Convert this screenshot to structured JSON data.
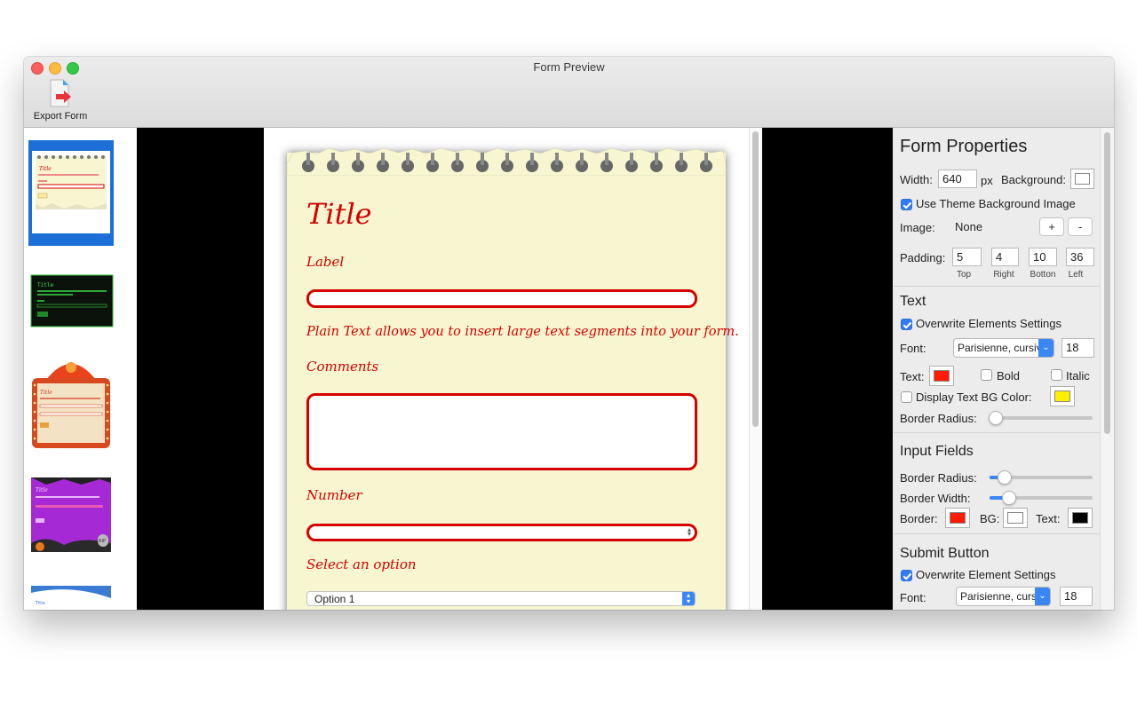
{
  "window": {
    "title": "Form Preview"
  },
  "toolbar": {
    "export_label": "Export Form"
  },
  "form": {
    "title": "Title",
    "label": "Label",
    "plain_text": "Plain Text allows you to insert large text segments into your form.",
    "comments": "Comments",
    "number": "Number",
    "select_label": "Select an option",
    "select_value": "Option 1"
  },
  "properties": {
    "heading": "Form Properties",
    "width_label": "Width:",
    "width_value": "640",
    "width_unit": "px",
    "background_label": "Background:",
    "use_theme_bg": "Use Theme Background Image",
    "image_label": "Image:",
    "image_value": "None",
    "plus": "+",
    "minus": "-",
    "padding_label": "Padding:",
    "padding": [
      {
        "value": "5",
        "caption": "Top"
      },
      {
        "value": "4",
        "caption": "Right"
      },
      {
        "value": "10",
        "caption": "Botton"
      },
      {
        "value": "36",
        "caption": "Left"
      }
    ],
    "text_section": {
      "heading": "Text",
      "overwrite": "Overwrite Elements Settings",
      "font_label": "Font:",
      "font_value": "Parisienne, cursive",
      "font_size": "18",
      "text_label": "Text:",
      "bold": "Bold",
      "italic": "Italic",
      "display_bg": "Display Text BG Color:",
      "border_radius": "Border Radius:"
    },
    "input_fields": {
      "heading": "Input Fields",
      "border_radius": "Border Radius:",
      "border_width": "Border Width:",
      "border": "Border:",
      "bg": "BG:",
      "text": "Text:"
    },
    "submit": {
      "heading": "Submit Button",
      "overwrite": "Overwrite Element Settings",
      "font_label": "Font:",
      "font_value": "Parisienne, cursive",
      "font_size": "18"
    }
  },
  "colors": {
    "text_color": "#ff1a00",
    "text_bg_color": "#ffee00",
    "border_color": "#ff1a00",
    "bg_color": "#ffffff",
    "input_text_color": "#000000",
    "form_accent": "#d40000",
    "paper": "#f7f6d0"
  },
  "sliders": {
    "text_border_radius": 0.06,
    "input_border_radius": 0.15,
    "input_border_width": 0.19
  },
  "thumbnails": [
    {
      "name": "Notebook",
      "title": "Title"
    },
    {
      "name": "Terminal",
      "title": "Title"
    },
    {
      "name": "Circus",
      "title": "Title"
    },
    {
      "name": "Halloween",
      "title": "Title"
    },
    {
      "name": "Blue",
      "title": "Title"
    }
  ]
}
